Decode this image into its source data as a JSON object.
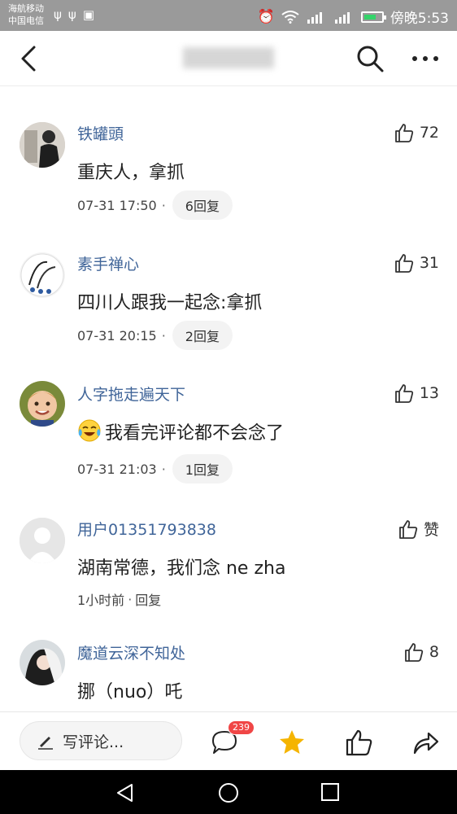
{
  "status_bar": {
    "carrier1": "海航移动",
    "carrier2": "中国电信",
    "time_text": "傍晚5:53"
  },
  "comments": [
    {
      "username": "铁罐頭",
      "likes": "72",
      "text": "重庆人，拿抓",
      "time": "07-31 17:50",
      "replies": "6回复"
    },
    {
      "username": "素手禅心",
      "likes": "31",
      "text": "四川人跟我一起念:拿抓",
      "time": "07-31 20:15",
      "replies": "2回复"
    },
    {
      "username": "人字拖走遍天下",
      "likes": "13",
      "text": "我看完评论都不会念了",
      "time": "07-31 21:03",
      "replies": "1回复"
    },
    {
      "username": "用户01351793838",
      "likes": "赞",
      "text": "湖南常德，我们念 ne zha",
      "time": "1小时前",
      "replies": "回复"
    },
    {
      "username": "魔道云深不知处",
      "likes": "8",
      "text": "挪（nuo）吒"
    }
  ],
  "bottom_bar": {
    "write_placeholder": "写评论...",
    "comment_count": "239"
  },
  "colors": {
    "username": "#406599",
    "star": "#f5b400",
    "badge": "#f04646"
  }
}
